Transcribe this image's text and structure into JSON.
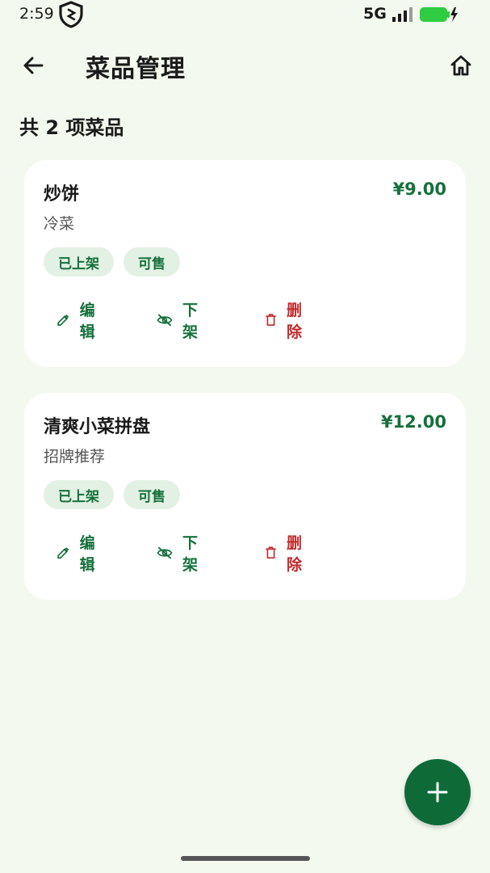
{
  "status_bar": {
    "time": "2:59",
    "network": "5G",
    "icons": [
      "shield-icon",
      "signal-icon",
      "battery-charging-icon"
    ]
  },
  "app_bar": {
    "title": "菜品管理",
    "back_icon": "arrow-left-icon",
    "home_icon": "home-icon"
  },
  "summary": {
    "count_text": "共 2 项菜品"
  },
  "dishes": [
    {
      "name": "炒饼",
      "price": "¥9.00",
      "category": "冷菜",
      "tags": [
        "已上架",
        "可售"
      ],
      "actions": {
        "edit": "编辑",
        "toggle": "下架",
        "delete": "删除"
      }
    },
    {
      "name": "清爽小菜拼盘",
      "price": "¥12.00",
      "category": "招牌推荐",
      "tags": [
        "已上架",
        "可售"
      ],
      "actions": {
        "edit": "编辑",
        "toggle": "下架",
        "delete": "删除"
      }
    }
  ],
  "fab": {
    "icon": "plus-icon"
  },
  "colors": {
    "accent": "#17703d",
    "fab": "#0e6b38",
    "danger": "#c22a2a",
    "tag_bg": "#e2f1e3",
    "background": "#f3f9ef"
  }
}
